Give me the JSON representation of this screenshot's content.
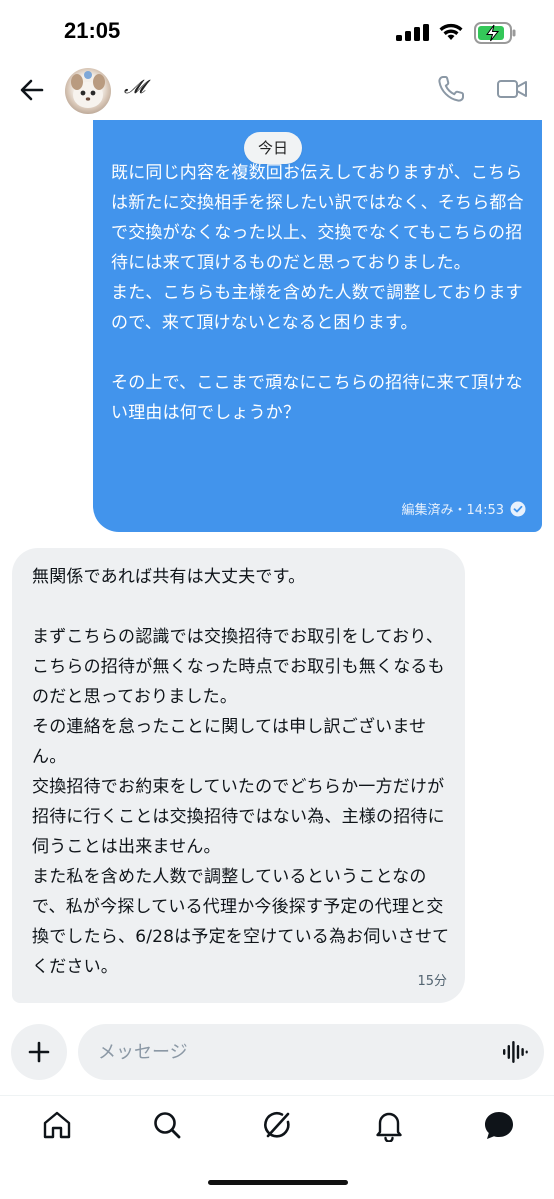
{
  "status_bar": {
    "time": "21:05"
  },
  "header": {
    "contact_name": "𝓜",
    "back_icon": "back-arrow-icon",
    "call_icon": "phone-icon",
    "video_icon": "video-camera-icon"
  },
  "date_divider": "今日",
  "messages": [
    {
      "direction": "outgoing",
      "text": "既に同じ内容を複数回お伝えしておりますが、こちらは新たに交換相手を探したい訳ではなく、そちら都合で交換がなくなった以上、交換でなくてもこちらの招待には来て頂けるものだと思っておりました。\nまた、こちらも主様を含めた人数で調整しておりますので、来て頂けないとなると困ります。\n\nその上で、ここまで頑なにこちらの招待に来て頂けない理由は何でしょうか？",
      "meta": "編集済み・14:53",
      "read_icon": "check-circle-icon"
    },
    {
      "direction": "incoming",
      "text": "無関係であれば共有は大丈夫です。\n\nまずこちらの認識では交換招待でお取引をしており、こちらの招待が無くなった時点でお取引も無くなるものだと思っておりました。\nその連絡を怠ったことに関しては申し訳ございません。\n交換招待でお約束をしていたのでどちらか一方だけが招待に行くことは交換招待ではない為、主様の招待に伺うことは出来ません。\nまた私を含めた人数で調整しているということなので、私が今探している代理か今後探す予定の代理と交換でしたら、6/28は予定を空けている為お伺いさせてください。",
      "meta": "15分"
    }
  ],
  "composer": {
    "placeholder": "メッセージ",
    "plus_icon": "plus-icon",
    "voice_icon": "voice-wave-icon"
  },
  "bottom_nav": [
    "home-icon",
    "search-icon",
    "grok-icon",
    "bell-icon",
    "messages-icon"
  ],
  "colors": {
    "outgoing_bubble": "#4294ec",
    "incoming_bubble": "#eef0f2",
    "battery_green": "#34c759"
  }
}
